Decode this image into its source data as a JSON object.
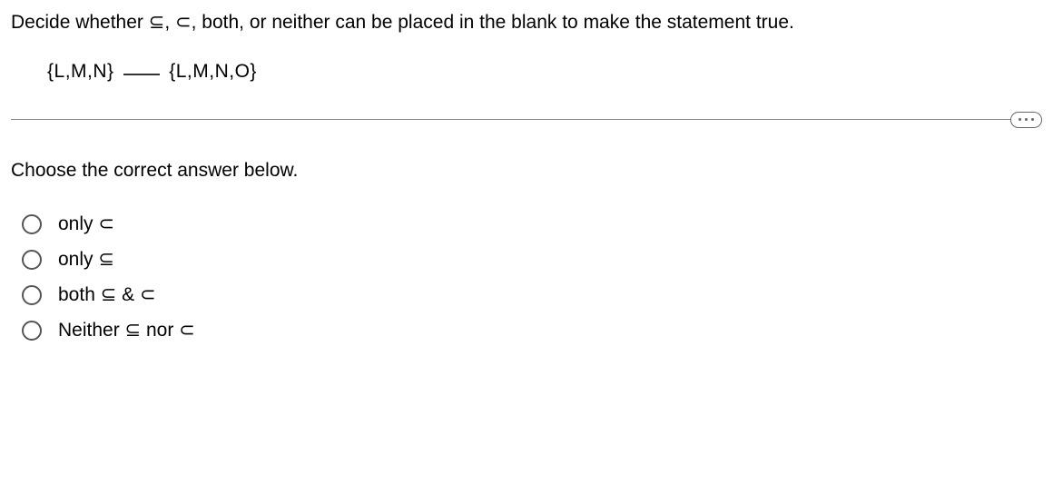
{
  "question": "Decide whether ⊆, ⊂, both, or neither can be placed in the blank to make the statement true.",
  "statement_left": "{L,M,N}",
  "statement_right": "{L,M,N,O}",
  "instruction": "Choose the correct answer below.",
  "options": [
    {
      "label": "only ⊂"
    },
    {
      "label": "only ⊆"
    },
    {
      "label": "both ⊆ & ⊂"
    },
    {
      "label": "Neither ⊆ nor ⊂"
    }
  ]
}
